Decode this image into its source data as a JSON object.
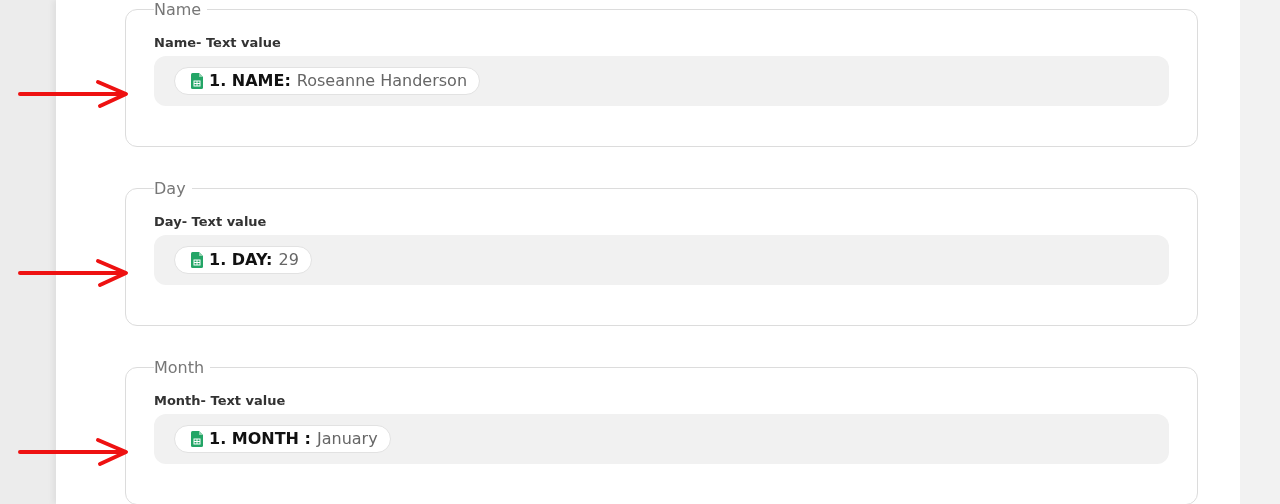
{
  "fields": [
    {
      "legend": "Name",
      "label": "Name- Text value",
      "token": {
        "key": "1. NAME:",
        "value": "Roseanne Handerson"
      },
      "annotated": true
    },
    {
      "legend": "Day",
      "label": "Day- Text value",
      "token": {
        "key": "1. DAY:",
        "value": "29"
      },
      "annotated": true
    },
    {
      "legend": "Month",
      "label": "Month- Text value",
      "token": {
        "key": "1. MONTH :",
        "value": "January"
      },
      "annotated": true
    }
  ]
}
